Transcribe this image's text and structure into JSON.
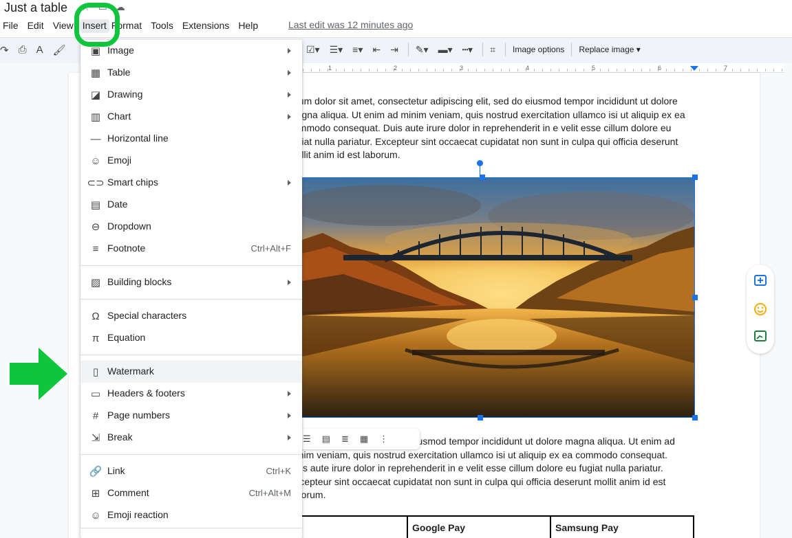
{
  "doc": {
    "title": "Just a table",
    "last_edit": "Last edit was 12 minutes ago"
  },
  "menubar": [
    "File",
    "Edit",
    "View",
    "Insert",
    "Format",
    "Tools",
    "Extensions",
    "Help"
  ],
  "toolbar": {
    "image_options": "Image options",
    "replace_image": "Replace image"
  },
  "ruler": [
    "1",
    "2",
    "3",
    "4",
    "5",
    "6",
    "7"
  ],
  "insert_menu": {
    "items": [
      {
        "label": "Image",
        "icon": "image-icon",
        "submenu": true,
        "shortcut": ""
      },
      {
        "label": "Table",
        "icon": "table-icon",
        "submenu": true,
        "shortcut": ""
      },
      {
        "label": "Drawing",
        "icon": "drawing-icon",
        "submenu": true,
        "shortcut": ""
      },
      {
        "label": "Chart",
        "icon": "chart-icon",
        "submenu": true,
        "shortcut": ""
      },
      {
        "label": "Horizontal line",
        "icon": "horizontal-line-icon",
        "submenu": false,
        "shortcut": ""
      },
      {
        "label": "Emoji",
        "icon": "emoji-icon",
        "submenu": false,
        "shortcut": ""
      },
      {
        "label": "Smart chips",
        "icon": "smart-chips-icon",
        "submenu": true,
        "shortcut": ""
      },
      {
        "label": "Date",
        "icon": "calendar-icon",
        "submenu": false,
        "shortcut": ""
      },
      {
        "label": "Dropdown",
        "icon": "dropdown-icon",
        "submenu": false,
        "shortcut": ""
      },
      {
        "label": "Footnote",
        "icon": "footnote-icon",
        "submenu": false,
        "shortcut": "Ctrl+Alt+F"
      },
      {
        "label": "Building blocks",
        "icon": "building-blocks-icon",
        "submenu": true,
        "shortcut": ""
      },
      {
        "label": "Special characters",
        "icon": "omega-icon",
        "submenu": false,
        "shortcut": ""
      },
      {
        "label": "Equation",
        "icon": "pi-icon",
        "submenu": false,
        "shortcut": ""
      },
      {
        "label": "Watermark",
        "icon": "watermark-icon",
        "submenu": false,
        "shortcut": ""
      },
      {
        "label": "Headers & footers",
        "icon": "headers-footers-icon",
        "submenu": true,
        "shortcut": ""
      },
      {
        "label": "Page numbers",
        "icon": "hash-icon",
        "submenu": true,
        "shortcut": ""
      },
      {
        "label": "Break",
        "icon": "break-icon",
        "submenu": true,
        "shortcut": ""
      },
      {
        "label": "Link",
        "icon": "link-icon",
        "submenu": false,
        "shortcut": "Ctrl+K"
      },
      {
        "label": "Comment",
        "icon": "comment-icon",
        "submenu": false,
        "shortcut": "Ctrl+Alt+M"
      },
      {
        "label": "Emoji reaction",
        "icon": "emoji-reaction-icon",
        "submenu": false,
        "shortcut": ""
      }
    ]
  },
  "body": {
    "para1": "psum dolor sit amet, consectetur adipiscing elit, sed do eiusmod tempor incididunt ut dolore magna aliqua. Ut enim ad minim veniam, quis nostrud exercitation ullamco isi ut aliquip ex ea commodo consequat. Duis aute irure dolor in reprehenderit in e velit esse cillum dolore eu fugiat nulla pariatur. Excepteur sint occaecat cupidatat non sunt in culpa qui officia deserunt mollit anim id est laborum.",
    "para2": "ctetur adipiscing elit, sed do eiusmod tempor incididunt ut dolore magna aliqua. Ut enim ad minim veniam, quis nostrud exercitation ullamco isi ut aliquip ex ea commodo consequat. Duis aute irure dolor in reprehenderit in e velit esse cillum dolore eu fugiat nulla pariatur. Excepteur sint occaecat cupidatat non sunt in culpa qui officia deserunt mollit anim id est laborum.",
    "table_headers": [
      "Google Pay",
      "Samsung Pay"
    ]
  },
  "colors": {
    "highlight_green": "#0fc53e",
    "selection_blue": "#1a73e8",
    "side_add": "#1a73e8",
    "side_emoji": "#f9ab00",
    "side_suggest": "#188038"
  }
}
